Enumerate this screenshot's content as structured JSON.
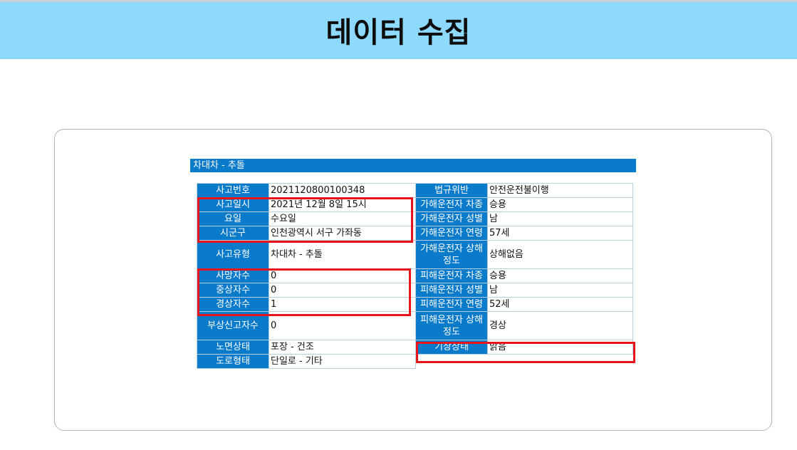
{
  "header": {
    "title": "데이터 수집"
  },
  "section": {
    "title": "차대차 - 추돌"
  },
  "rows": [
    {
      "left_label": "사고번호",
      "left_value": "2021120800100348",
      "right_label": "법규위반",
      "right_value": "안전운전불이행"
    },
    {
      "left_label": "사고일시",
      "left_value": "2021년 12월 8일 15시",
      "right_label": "가해운전자 차종",
      "right_value": "승용"
    },
    {
      "left_label": "요일",
      "left_value": "수요일",
      "right_label": "가해운전자 성별",
      "right_value": "남"
    },
    {
      "left_label": "시군구",
      "left_value": "인천광역시 서구 가좌동",
      "right_label": "가해운전자 연령",
      "right_value": "57세"
    },
    {
      "left_label": "사고유형",
      "left_value": "차대차 - 추돌",
      "right_label": "가해운전자 상해정도",
      "right_value": "상해없음"
    },
    {
      "left_label": "사망자수",
      "left_value": "0",
      "right_label": "피해운전자 차종",
      "right_value": "승용"
    },
    {
      "left_label": "중상자수",
      "left_value": "0",
      "right_label": "피해운전자 성별",
      "right_value": "남"
    },
    {
      "left_label": "경상자수",
      "left_value": "1",
      "right_label": "피해운전자 연령",
      "right_value": "52세"
    },
    {
      "left_label": "부상신고자수",
      "left_value": "0",
      "right_label": "피해운전자 상해정도",
      "right_value": "경상"
    },
    {
      "left_label": "노면상태",
      "left_value": "포장 - 건조",
      "right_label": "기상상태",
      "right_value": "맑음"
    },
    {
      "left_label": "도로형태",
      "left_value": "단일로 - 기타"
    }
  ],
  "colors": {
    "header_bg": "#8ddafe",
    "label_bg": "#0a7acb",
    "highlight": "#e8141c"
  }
}
